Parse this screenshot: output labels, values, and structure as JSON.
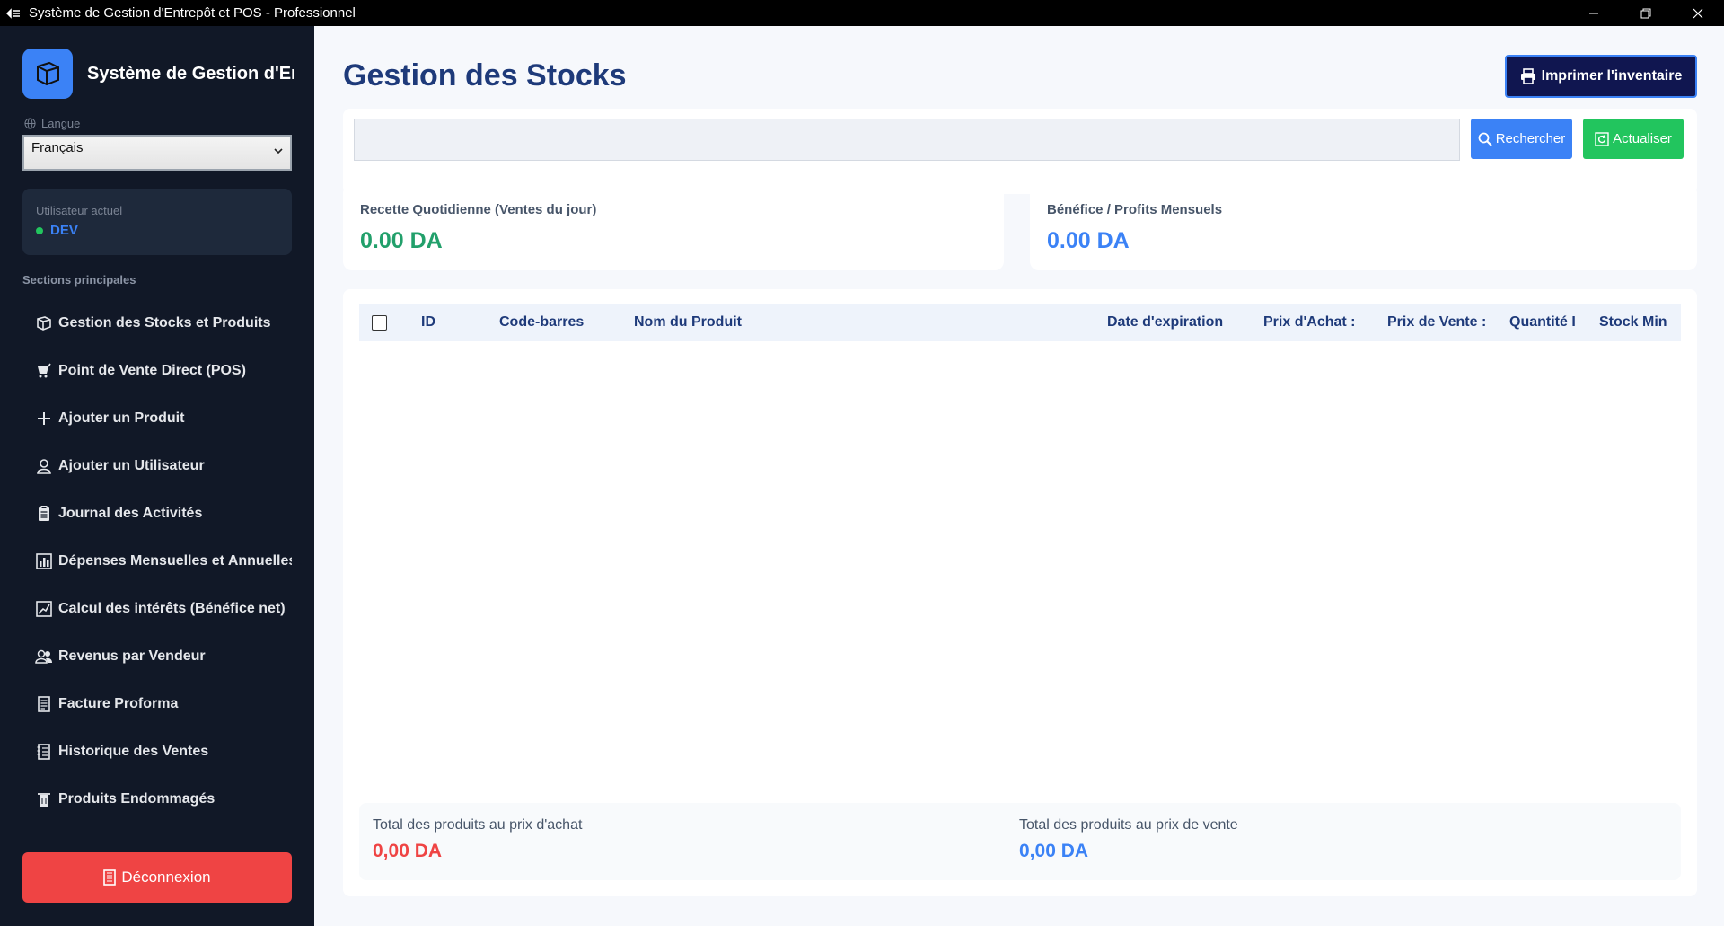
{
  "window": {
    "title": "Système de Gestion d'Entrepôt et POS - Professionnel"
  },
  "sidebar": {
    "brand_name": "Système de Gestion d'Entrepôt et POS",
    "language_label": "Langue",
    "language_value": "Français",
    "user_label": "Utilisateur actuel",
    "user_name": "DEV",
    "section_title": "Sections principales",
    "items": [
      {
        "label": "Gestion des Stocks et Produits",
        "icon": "box-icon"
      },
      {
        "label": "Point de Vente Direct (POS)",
        "icon": "cart-icon"
      },
      {
        "label": "Ajouter un Produit",
        "icon": "plus-icon"
      },
      {
        "label": "Ajouter un Utilisateur",
        "icon": "user-icon"
      },
      {
        "label": "Journal des Activités",
        "icon": "clipboard-icon"
      },
      {
        "label": "Dépenses Mensuelles et Annuelles",
        "icon": "bar-chart-icon"
      },
      {
        "label": "Calcul des intérêts (Bénéfice net)",
        "icon": "chart-line-icon"
      },
      {
        "label": "Revenus par Vendeur",
        "icon": "users-icon"
      },
      {
        "label": "Facture Proforma",
        "icon": "document-icon"
      },
      {
        "label": "Historique des Ventes",
        "icon": "ledger-icon"
      },
      {
        "label": "Produits Endommagés",
        "icon": "trash-icon"
      }
    ],
    "logout_label": "Déconnexion"
  },
  "main": {
    "title": "Gestion des Stocks",
    "print_label": "Imprimer l'inventaire",
    "search_placeholder": "",
    "search_label": "Rechercher",
    "refresh_label": "Actualiser",
    "stats": [
      {
        "label": "Recette Quotidienne (Ventes du jour)",
        "value": "0.00 DA",
        "color": "#22a06b"
      },
      {
        "label": "Bénéfice / Profits Mensuels",
        "value": "0.00 DA",
        "color": "#3b82f6"
      }
    ],
    "table": {
      "columns": [
        "ID",
        "Code-barres",
        "Nom du Produit",
        "Date d'expiration",
        "Prix d'Achat :",
        "Prix de Vente :",
        "Quantité I",
        "Stock Min"
      ],
      "rows": []
    },
    "totals": {
      "purchase_label": "Total des produits au prix d'achat",
      "purchase_value": "0,00 DA",
      "sale_label": "Total des produits au prix de vente",
      "sale_value": "0,00 DA"
    }
  },
  "colors": {
    "sidebar_bg": "#111827",
    "accent_blue": "#3b82f6",
    "success_green": "#22c55e",
    "danger_red": "#ef4444",
    "title_navy": "#1e3a7a"
  }
}
